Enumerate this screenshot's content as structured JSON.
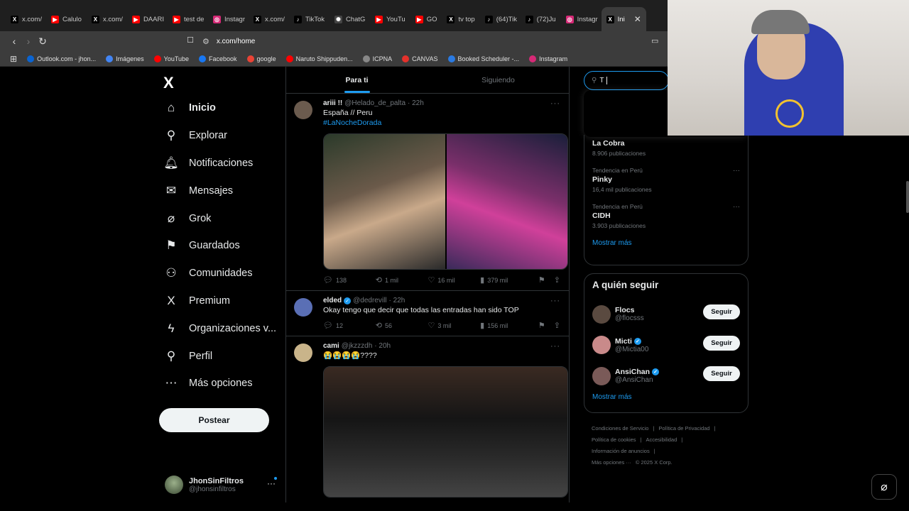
{
  "browser": {
    "tabs": [
      {
        "label": "x.com/",
        "icon": "X",
        "color": "#fff",
        "bg": "#000"
      },
      {
        "label": "Calulo",
        "icon": "▶",
        "color": "#fff",
        "bg": "#f00"
      },
      {
        "label": "x.com/",
        "icon": "X",
        "color": "#fff",
        "bg": "#000"
      },
      {
        "label": "DAARI",
        "icon": "▶",
        "color": "#fff",
        "bg": "#f00"
      },
      {
        "label": "test de",
        "icon": "▶",
        "color": "#fff",
        "bg": "#f00"
      },
      {
        "label": "Instagr",
        "icon": "◎",
        "color": "#fff",
        "bg": "#d62976"
      },
      {
        "label": "x.com/",
        "icon": "X",
        "color": "#fff",
        "bg": "#000"
      },
      {
        "label": "TikTok",
        "icon": "♪",
        "color": "#fff",
        "bg": "#000"
      },
      {
        "label": "ChatG",
        "icon": "✺",
        "color": "#fff",
        "bg": "#444"
      },
      {
        "label": "YouTu",
        "icon": "▶",
        "color": "#fff",
        "bg": "#f00"
      },
      {
        "label": "GO",
        "icon": "▶",
        "color": "#fff",
        "bg": "#f00"
      },
      {
        "label": "tv top",
        "icon": "X",
        "color": "#fff",
        "bg": "#000"
      },
      {
        "label": "(64)Tik",
        "icon": "♪",
        "color": "#fff",
        "bg": "#000"
      },
      {
        "label": "(72)Ju",
        "icon": "♪",
        "color": "#fff",
        "bg": "#000"
      },
      {
        "label": "Instagr",
        "icon": "◎",
        "color": "#fff",
        "bg": "#d62976"
      }
    ],
    "active_tab": {
      "label": "Ini",
      "icon": "X",
      "close": "✕"
    },
    "url": "x.com/home",
    "bookmarks": [
      {
        "label": "Outlook.com - jhon...",
        "color": "#0a64d2"
      },
      {
        "label": "Imágenes",
        "color": "#4285f4"
      },
      {
        "label": "YouTube",
        "color": "#f00"
      },
      {
        "label": "Facebook",
        "color": "#1877f2"
      },
      {
        "label": "google",
        "color": "#ea4335"
      },
      {
        "label": "Naruto Shippuden...",
        "color": "#f00"
      },
      {
        "label": "ICPNA",
        "color": "#888"
      },
      {
        "label": "CANVAS",
        "color": "#e4312b"
      },
      {
        "label": "Booked Scheduler -...",
        "color": "#2a7ae2"
      },
      {
        "label": "Instagram",
        "color": "#d62976"
      }
    ]
  },
  "logo": "X",
  "nav": [
    {
      "label": "Inicio",
      "icon": "⌂",
      "name": "home-icon",
      "active": true
    },
    {
      "label": "Explorar",
      "icon": "⚲",
      "name": "search-icon"
    },
    {
      "label": "Notificaciones",
      "icon": "🔔︎",
      "name": "bell-icon"
    },
    {
      "label": "Mensajes",
      "icon": "✉",
      "name": "envelope-icon"
    },
    {
      "label": "Grok",
      "icon": "⌀",
      "name": "grok-icon"
    },
    {
      "label": "Guardados",
      "icon": "⚑",
      "name": "bookmark-icon"
    },
    {
      "label": "Comunidades",
      "icon": "⚇",
      "name": "communities-icon"
    },
    {
      "label": "Premium",
      "icon": "X",
      "name": "premium-icon"
    },
    {
      "label": "Organizaciones v...",
      "icon": "ϟ",
      "name": "lightning-icon"
    },
    {
      "label": "Perfil",
      "icon": "⚲",
      "name": "profile-icon"
    },
    {
      "label": "Más opciones",
      "icon": "⋯",
      "name": "more-options-icon"
    }
  ],
  "post_button": "Postear",
  "account": {
    "name": "JhonSinFiltros",
    "handle": "@jhonsinfiltros",
    "more": "···"
  },
  "feed": {
    "tabs": [
      "Para ti",
      "Siguiendo"
    ],
    "tweets": [
      {
        "name": "ariii !!",
        "handle": "@Helado_de_palta",
        "time": "· 22h",
        "verified": false,
        "text": "España // Peru",
        "hashtag": "#LaNocheDorada",
        "media": true,
        "media_height": 192,
        "stats": {
          "replies": "138",
          "retweets": "1 mil",
          "likes": "16 mil",
          "views": "379 mil"
        },
        "avatar": "#6b5b4e"
      },
      {
        "name": "elded",
        "handle": "@dedrevill",
        "time": "· 22h",
        "verified": true,
        "text": "Okay tengo que decir que todas las entradas han sido TOP",
        "hashtag": "",
        "media": false,
        "stats": {
          "replies": "12",
          "retweets": "56",
          "likes": "3 mil",
          "views": "156 mil"
        },
        "avatar": "#5a6fb5"
      },
      {
        "name": "cami",
        "handle": "@jkzzzdh",
        "time": "· 20h",
        "verified": false,
        "text": "😭😭😭😭????",
        "hashtag": "",
        "media": true,
        "media_height": 185,
        "stats": null,
        "avatar": "#c9b48a"
      }
    ]
  },
  "right": {
    "search_value": "T",
    "trends": [
      {
        "context": "",
        "name": "La Cobra",
        "count": "8.906 publicaciones"
      },
      {
        "context": "Tendencia en Perú",
        "name": "Pinky",
        "count": "16,4 mil publicaciones"
      },
      {
        "context": "Tendencia en Perú",
        "name": "CIDH",
        "count": "3.903 publicaciones"
      }
    ],
    "trends_more": "Mostrar más",
    "wtf_title": "A quién seguir",
    "follow": [
      {
        "name": "Flocs",
        "handle": "@flocsss",
        "verified": false,
        "avatar": "#5a4a40"
      },
      {
        "name": "Micti",
        "handle": "@Mictia00",
        "verified": true,
        "avatar": "#c98a8a"
      },
      {
        "name": "AnsiChan",
        "handle": "@AnsiChan",
        "verified": true,
        "avatar": "#7a5a58"
      }
    ],
    "follow_label": "Seguir",
    "wtf_more": "Mostrar más",
    "footer": [
      "Condiciones de Servicio",
      "|",
      "Política de Privacidad",
      "|",
      "Política de cookies",
      "|",
      "Accesibilidad",
      "|",
      "Información de anuncios",
      "|",
      "Más opciones ···",
      "© 2025 X Corp."
    ]
  }
}
